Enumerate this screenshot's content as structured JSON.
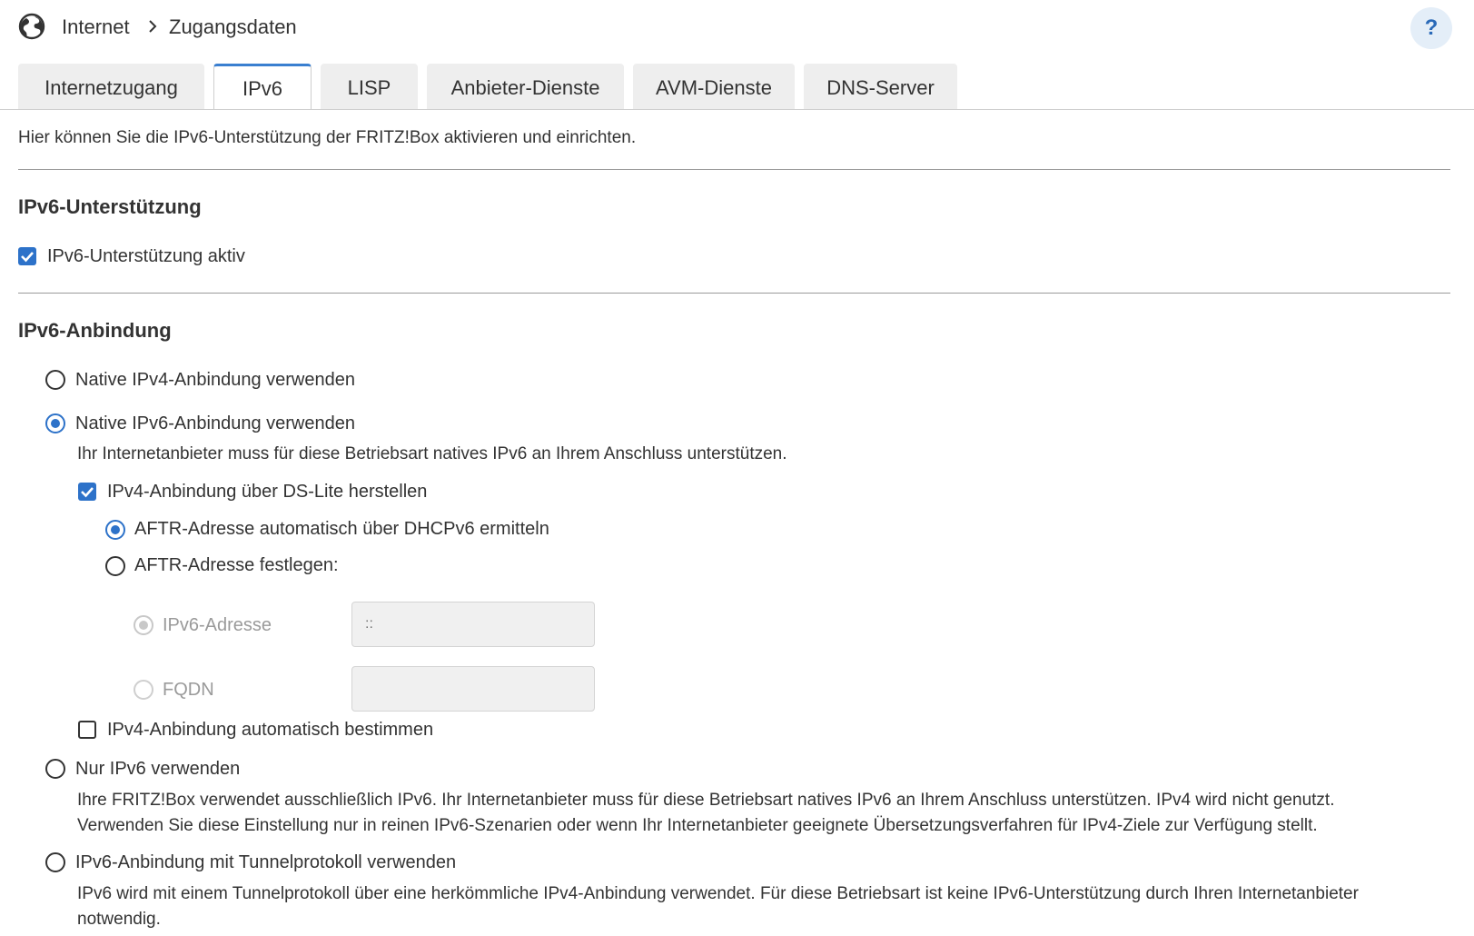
{
  "header": {
    "breadcrumb": [
      "Internet",
      "Zugangsdaten"
    ],
    "help_label": "?"
  },
  "tabs": [
    {
      "label": "Internetzugang",
      "active": false
    },
    {
      "label": "IPv6",
      "active": true
    },
    {
      "label": "LISP",
      "active": false
    },
    {
      "label": "Anbieter-Dienste",
      "active": false
    },
    {
      "label": "AVM-Dienste",
      "active": false
    },
    {
      "label": "DNS-Server",
      "active": false
    }
  ],
  "intro": "Hier können Sie die IPv6-Unterstützung der FRITZ!Box aktivieren und einrichten.",
  "support": {
    "heading": "IPv6-Unterstützung",
    "checkbox_label": "IPv6-Unterstützung aktiv",
    "checked": true
  },
  "binding": {
    "heading": "IPv6-Anbindung",
    "opt_native_ipv4": {
      "label": "Native IPv4-Anbindung verwenden",
      "selected": false
    },
    "opt_native_ipv6": {
      "label": "Native IPv6-Anbindung verwenden",
      "selected": true,
      "desc": "Ihr Internetanbieter muss für diese Betriebsart natives IPv6 an Ihrem Anschluss unterstützen."
    },
    "dslite": {
      "label": "IPv4-Anbindung über DS-Lite herstellen",
      "checked": true,
      "aftr_auto_label": "AFTR-Adresse automatisch über DHCPv6 ermitteln",
      "aftr_manual_label": "AFTR-Adresse festlegen:",
      "ipv6_address_label": "IPv6-Adresse",
      "ipv6_address_placeholder": "::",
      "fqdn_label": "FQDN",
      "fqdn_value": ""
    },
    "auto_ipv4": {
      "label": "IPv4-Anbindung automatisch bestimmen",
      "checked": false
    },
    "opt_ipv6_only": {
      "label": "Nur IPv6 verwenden",
      "selected": false,
      "desc1": "Ihre FRITZ!Box verwendet ausschließlich IPv6. Ihr Internetanbieter muss für diese Betriebsart natives IPv6 an Ihrem Anschluss unterstützen. IPv4 wird nicht genutzt.",
      "desc2": "Verwenden Sie diese Einstellung nur in reinen IPv6-Szenarien oder wenn Ihr Internetanbieter geeignete Übersetzungsverfahren für IPv4-Ziele zur Verfügung stellt."
    },
    "opt_tunnel": {
      "label": "IPv6-Anbindung mit Tunnelprotokoll verwenden",
      "selected": false,
      "desc1": "IPv6 wird mit einem Tunnelprotokoll über eine herkömmliche IPv4-Anbindung verwendet. Für diese Betriebsart ist keine IPv6-Unterstützung durch Ihren Internetanbieter",
      "desc2": "notwendig."
    }
  },
  "colors": {
    "accent": "#2d72c9",
    "text": "#333333",
    "disabled": "#9a9a9a"
  }
}
